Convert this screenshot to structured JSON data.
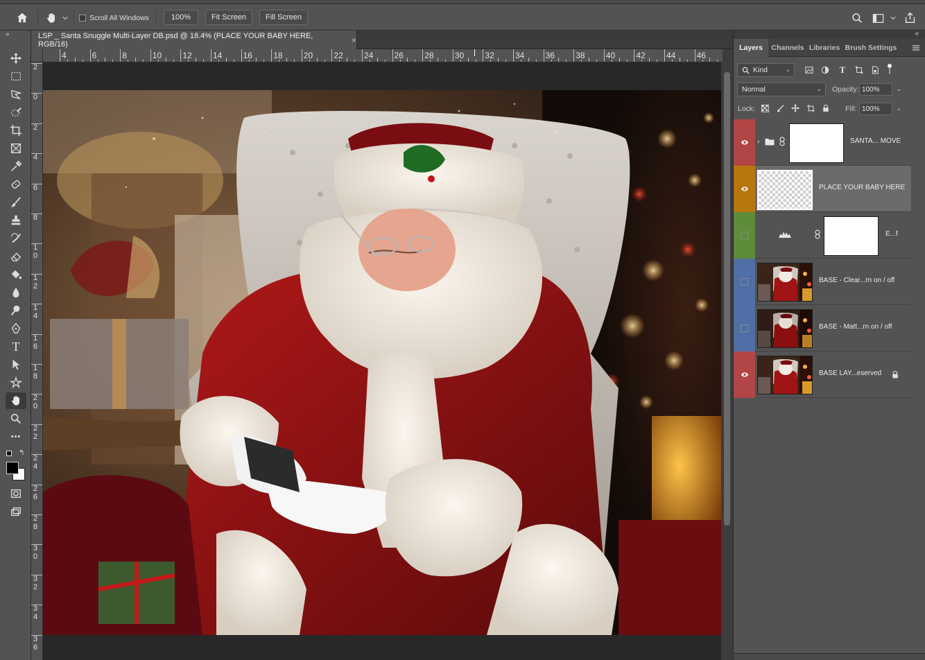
{
  "options_bar": {
    "scroll_all_label": "Scroll All Windows",
    "zoom_button": "100%",
    "fit_screen_button": "Fit Screen",
    "fill_screen_button": "Fill Screen",
    "icons": [
      "home-icon",
      "hand-tool-icon",
      "search-icon",
      "workspace-icon",
      "share-icon"
    ]
  },
  "document": {
    "tab_title": "LSP _ Santa Snuggle Multi-Layer DB.psd @ 18.4% (PLACE YOUR BABY HERE, RGB/16)",
    "tab_close": "×",
    "ruler_top_ticks": [
      "4",
      "6",
      "8",
      "10",
      "12",
      "14",
      "16",
      "18",
      "20",
      "22",
      "24",
      "26",
      "28",
      "30",
      "32",
      "34",
      "36",
      "38",
      "40",
      "42",
      "44",
      "46"
    ],
    "ruler_left_ticks": [
      [
        "2"
      ],
      [
        "0"
      ],
      [
        "2"
      ],
      [
        "4"
      ],
      [
        "6"
      ],
      [
        "8"
      ],
      [
        "1",
        "0"
      ],
      [
        "1",
        "2"
      ],
      [
        "1",
        "4"
      ],
      [
        "1",
        "6"
      ],
      [
        "1",
        "8"
      ],
      [
        "2",
        "0"
      ],
      [
        "2",
        "2"
      ],
      [
        "2",
        "4"
      ],
      [
        "2",
        "6"
      ],
      [
        "2",
        "8"
      ],
      [
        "3",
        "0"
      ],
      [
        "3",
        "2"
      ],
      [
        "3",
        "4"
      ],
      [
        "3",
        "6"
      ]
    ]
  },
  "tools": [
    "move-tool-icon",
    "marquee-tool-icon",
    "lasso-tool-icon",
    "quick-select-tool-icon",
    "crop-tool-icon",
    "frame-tool-icon",
    "eyedropper-tool-icon",
    "healing-tool-icon",
    "brush-tool-icon",
    "stamp-tool-icon",
    "history-brush-tool-icon",
    "eraser-tool-icon",
    "paint-bucket-tool-icon",
    "blur-tool-icon",
    "dodge-tool-icon",
    "pen-tool-icon",
    "type-tool-icon",
    "path-select-tool-icon",
    "custom-shape-tool-icon",
    "hand-tool-icon",
    "zoom-tool-icon",
    "more-tools-icon"
  ],
  "type_tool_glyph": "T",
  "more_tools_glyph": "•••",
  "panels": {
    "tabs": [
      "Layers",
      "Channels",
      "Libraries",
      "Brush Settings"
    ],
    "filter_kind": "Kind",
    "blend_mode": "Normal",
    "opacity_label": "Opacity:",
    "opacity_value": "100%",
    "lock_label": "Lock:",
    "fill_label": "Fill:",
    "fill_value": "100%",
    "layers": [
      {
        "name": "SANTA... MOVE",
        "color": "#b24545",
        "visible": true,
        "type": "group",
        "thumb": "white"
      },
      {
        "name": "PLACE YOUR BABY HERE",
        "color": "#b8760e",
        "visible": true,
        "type": "pixel",
        "thumb": "transparent",
        "selected": true
      },
      {
        "name": "E...f",
        "color": "#5e8c3a",
        "visible": false,
        "type": "adjustment",
        "thumb": "white"
      },
      {
        "name": "BASE - Clear...rn on / off",
        "color": "#4f6fa6",
        "visible": false,
        "type": "pixel",
        "thumb": "photo"
      },
      {
        "name": "BASE - Matt...rn on / off",
        "color": "#4f6fa6",
        "visible": false,
        "type": "pixel",
        "thumb": "photo"
      },
      {
        "name": "BASE LAY...eserved",
        "color": "#b24545",
        "visible": true,
        "type": "pixel",
        "thumb": "photo",
        "locked": true
      }
    ]
  }
}
